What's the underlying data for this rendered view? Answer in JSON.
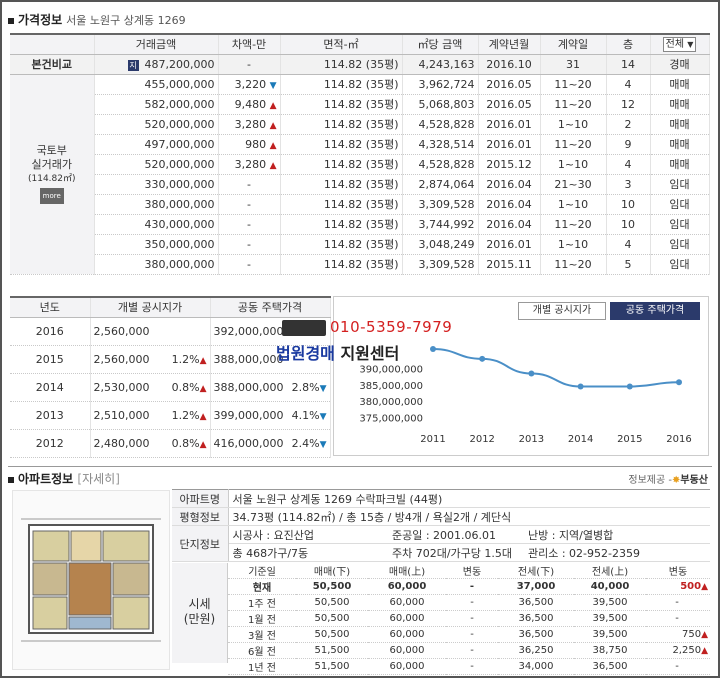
{
  "price_section": {
    "title": "가격정보",
    "location": "서울 노원구 상계동 1269"
  },
  "headers": [
    "거래금액",
    "차액-만",
    "면적-㎡",
    "㎡당 금액",
    "계약년월",
    "계약일",
    "층"
  ],
  "filter": {
    "selected": "전체"
  },
  "own": {
    "label": "본건비교",
    "badge": "지",
    "amount": "487,200,000",
    "diff": "-",
    "area": "114.82 (35평)",
    "per_m2": "4,243,163",
    "ym": "2016.10",
    "day": "31",
    "floor": "14",
    "type": "경매"
  },
  "side_label": {
    "line1": "국토부",
    "line2": "실거래가",
    "line3": "(114.82㎡)",
    "more": "more"
  },
  "rows": [
    {
      "amount": "455,000,000",
      "diff": "3,220",
      "arrow": "▼",
      "area": "114.82 (35평)",
      "per_m2": "3,962,724",
      "ym": "2016.05",
      "day": "11~20",
      "floor": "4",
      "type": "매매"
    },
    {
      "amount": "582,000,000",
      "diff": "9,480",
      "arrow": "▲",
      "area": "114.82 (35평)",
      "per_m2": "5,068,803",
      "ym": "2016.05",
      "day": "11~20",
      "floor": "12",
      "type": "매매"
    },
    {
      "amount": "520,000,000",
      "diff": "3,280",
      "arrow": "▲",
      "area": "114.82 (35평)",
      "per_m2": "4,528,828",
      "ym": "2016.01",
      "day": "1~10",
      "floor": "2",
      "type": "매매"
    },
    {
      "amount": "497,000,000",
      "diff": "980",
      "arrow": "▲",
      "area": "114.82 (35평)",
      "per_m2": "4,328,514",
      "ym": "2016.01",
      "day": "11~20",
      "floor": "9",
      "type": "매매"
    },
    {
      "amount": "520,000,000",
      "diff": "3,280",
      "arrow": "▲",
      "area": "114.82 (35평)",
      "per_m2": "4,528,828",
      "ym": "2015.12",
      "day": "1~10",
      "floor": "4",
      "type": "매매"
    },
    {
      "amount": "330,000,000",
      "diff": "-",
      "arrow": "",
      "area": "114.82 (35평)",
      "per_m2": "2,874,064",
      "ym": "2016.04",
      "day": "21~30",
      "floor": "3",
      "type": "임대"
    },
    {
      "amount": "380,000,000",
      "diff": "-",
      "arrow": "",
      "area": "114.82 (35평)",
      "per_m2": "3,309,528",
      "ym": "2016.04",
      "day": "1~10",
      "floor": "10",
      "type": "임대"
    },
    {
      "amount": "430,000,000",
      "diff": "-",
      "arrow": "",
      "area": "114.82 (35평)",
      "per_m2": "3,744,992",
      "ym": "2016.04",
      "day": "11~20",
      "floor": "10",
      "type": "임대"
    },
    {
      "amount": "350,000,000",
      "diff": "-",
      "arrow": "",
      "area": "114.82 (35평)",
      "per_m2": "3,048,249",
      "ym": "2016.01",
      "day": "1~10",
      "floor": "4",
      "type": "임대"
    },
    {
      "amount": "380,000,000",
      "diff": "-",
      "arrow": "",
      "area": "114.82 (35평)",
      "per_m2": "3,309,528",
      "ym": "2015.11",
      "day": "11~20",
      "floor": "5",
      "type": "임대"
    }
  ],
  "gosi_headers": [
    "년도",
    "개별 공시지가",
    "공동 주택가격"
  ],
  "gosi_rows": [
    {
      "year": "2016",
      "land": "2,560,000",
      "land_pct": "",
      "land_arrow": "",
      "house": "392,000,000",
      "house_pct": "",
      "house_arrow": ""
    },
    {
      "year": "2015",
      "land": "2,560,000",
      "land_pct": "1.2%",
      "land_arrow": "▲",
      "house": "388,000,000",
      "house_pct": "",
      "house_arrow": ""
    },
    {
      "year": "2014",
      "land": "2,530,000",
      "land_pct": "0.8%",
      "land_arrow": "▲",
      "house": "388,000,000",
      "house_pct": "2.8%",
      "house_arrow": "▼"
    },
    {
      "year": "2013",
      "land": "2,510,000",
      "land_pct": "1.2%",
      "land_arrow": "▲",
      "house": "399,000,000",
      "house_pct": "4.1%",
      "house_arrow": "▼"
    },
    {
      "year": "2012",
      "land": "2,480,000",
      "land_pct": "0.8%",
      "land_arrow": "▲",
      "house": "416,000,000",
      "house_pct": "2.4%",
      "house_arrow": "▼"
    }
  ],
  "chart_tabs": [
    "개별 공시지가",
    "공동 주택가격"
  ],
  "watermark": {
    "phone": "010-5359-7979",
    "name_a": "법원경매",
    "name_b": " 지원센터"
  },
  "chart_data": {
    "type": "line",
    "x": [
      "2011",
      "2012",
      "2013",
      "2014",
      "2015",
      "2016"
    ],
    "series": [
      {
        "values": [
          396000000,
          393000000,
          388500000,
          384500000,
          384500000,
          385800000
        ]
      }
    ],
    "y_ticks": [
      "375,000,000",
      "380,000,000",
      "385,000,000",
      "390,000,000"
    ],
    "ylim": [
      373000000,
      400000000
    ],
    "color": "#4a8fc7"
  },
  "apt_section": {
    "title": "아파트정보",
    "detail_link": "자세히",
    "provider_label": "정보제공 -",
    "provider": "부동산"
  },
  "apt": {
    "name_label": "아파트명",
    "name": "서울 노원구 상계동 1269 수락파크빌 (44평)",
    "size_label": "평형정보",
    "size": "34.73평 (114.82㎡) / 총 15층 / 방4개 / 욕실2개 / 계단식",
    "complex_label": "단지정보",
    "builder": "시공사 : 요진산업",
    "completed": "준공일 : 2001.06.01",
    "heating": "난방 : 지역/열병합",
    "households": "총 468가구/7동",
    "parking": "주차 702대/가구당 1.5대",
    "office": "관리소 : 02-952-2359"
  },
  "market": {
    "label_a": "시세",
    "label_b": "(만원)",
    "headers": [
      "기준일",
      "매매(下)",
      "매매(上)",
      "변동",
      "전세(下)",
      "전세(上)",
      "변동"
    ],
    "rows": [
      {
        "d": "현재",
        "a": "50,500",
        "b": "60,000",
        "c": "-",
        "e": "37,000",
        "f": "40,000",
        "g": "500",
        "arrow": "▲"
      },
      {
        "d": "1주 전",
        "a": "50,500",
        "b": "60,000",
        "c": "-",
        "e": "36,500",
        "f": "39,500",
        "g": "-",
        "arrow": ""
      },
      {
        "d": "1월 전",
        "a": "50,500",
        "b": "60,000",
        "c": "-",
        "e": "36,500",
        "f": "39,500",
        "g": "-",
        "arrow": ""
      },
      {
        "d": "3월 전",
        "a": "50,500",
        "b": "60,000",
        "c": "-",
        "e": "36,500",
        "f": "39,500",
        "g": "750",
        "arrow": "▲"
      },
      {
        "d": "6월 전",
        "a": "51,500",
        "b": "60,000",
        "c": "-",
        "e": "36,250",
        "f": "38,750",
        "g": "2,250",
        "arrow": "▲"
      },
      {
        "d": "1년 전",
        "a": "51,500",
        "b": "60,000",
        "c": "-",
        "e": "34,000",
        "f": "36,500",
        "g": "-",
        "arrow": ""
      }
    ]
  },
  "colors": {
    "up": "#c02020",
    "down": "#1a7ab8",
    "line": "#4a8fc7",
    "tab_on": "#2b3a6b"
  }
}
